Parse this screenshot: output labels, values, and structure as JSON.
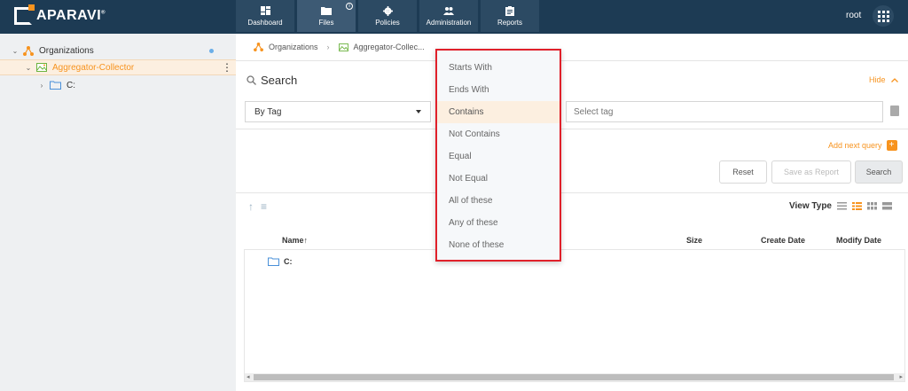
{
  "brand": {
    "name": "APARAVI",
    "mark": "®"
  },
  "nav": {
    "tabs": [
      {
        "label": "Dashboard",
        "icon": "dashboard-icon"
      },
      {
        "label": "Files",
        "icon": "folder-icon",
        "info": "i"
      },
      {
        "label": "Policies",
        "icon": "gear-icon"
      },
      {
        "label": "Administration",
        "icon": "users-icon"
      },
      {
        "label": "Reports",
        "icon": "clipboard-icon"
      }
    ],
    "user": "root"
  },
  "sidebar": {
    "items": [
      {
        "label": "Organizations",
        "chevron": "⌄"
      },
      {
        "label": "Aggregator-Collector",
        "chevron": "⌄"
      },
      {
        "label": "C:",
        "chevron": "›"
      }
    ],
    "kebab": "⋮"
  },
  "breadcrumb": {
    "items": [
      "Organizations",
      "Aggregator-Collec..."
    ],
    "separator": "›"
  },
  "search": {
    "title": "Search",
    "hide_label": "Hide",
    "by_label": "By Tag",
    "tag_placeholder": "Select tag",
    "add_query": "Add next query",
    "add_plus": "+",
    "reset": "Reset",
    "save_report": "Save as Report",
    "search": "Search"
  },
  "toolbar": {
    "view_type": "View Type",
    "sort_up": "↑",
    "sort_list": "≡"
  },
  "table": {
    "columns": {
      "name": "Name",
      "size": "Size",
      "create": "Create Date",
      "modify": "Modify Date"
    },
    "name_sort": "↑",
    "rows": [
      {
        "name": "C:"
      }
    ],
    "scroll_left": "◂",
    "scroll_right": "▸"
  },
  "dropdown": {
    "options": [
      "Starts With",
      "Ends With",
      "Contains",
      "Not Contains",
      "Equal",
      "Not Equal",
      "All of these",
      "Any of these",
      "None of these"
    ],
    "selected": "Contains"
  },
  "colors": {
    "topbar": "#1d3b54",
    "accent": "#f7931e",
    "highlight_border": "#e0202a"
  }
}
